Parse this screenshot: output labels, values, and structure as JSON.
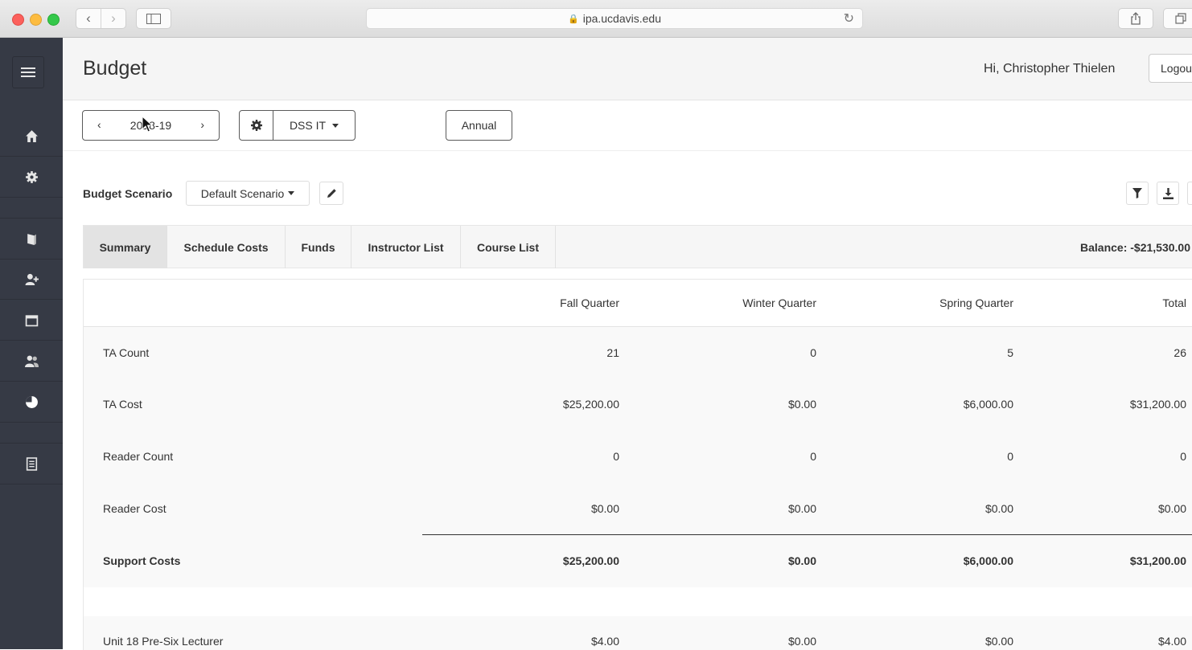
{
  "browser": {
    "url": "ipa.ucdavis.edu"
  },
  "header": {
    "title": "Budget",
    "greeting": "Hi, Christopher Thielen",
    "logout_label": "Logou"
  },
  "toolbar": {
    "year": "2018-19",
    "department": "DSS IT",
    "view_mode": "Annual"
  },
  "scenario": {
    "label": "Budget Scenario",
    "selected": "Default Scenario"
  },
  "tabs": [
    {
      "label": "Summary",
      "active": true
    },
    {
      "label": "Schedule Costs",
      "active": false
    },
    {
      "label": "Funds",
      "active": false
    },
    {
      "label": "Instructor List",
      "active": false
    },
    {
      "label": "Course List",
      "active": false
    }
  ],
  "balance": "Balance: -$21,530.00",
  "table": {
    "columns": [
      "Fall Quarter",
      "Winter Quarter",
      "Spring Quarter",
      "Total"
    ],
    "rows": [
      {
        "label": "TA Count",
        "values": [
          "21",
          "0",
          "5",
          "26"
        ]
      },
      {
        "label": "TA Cost",
        "values": [
          "$25,200.00",
          "$0.00",
          "$6,000.00",
          "$31,200.00"
        ]
      },
      {
        "label": "Reader Count",
        "values": [
          "0",
          "0",
          "0",
          "0"
        ]
      },
      {
        "label": "Reader Cost",
        "values": [
          "$0.00",
          "$0.00",
          "$0.00",
          "$0.00"
        ]
      },
      {
        "label": "Support Costs",
        "values": [
          "$25,200.00",
          "$0.00",
          "$6,000.00",
          "$31,200.00"
        ]
      },
      {
        "label": "Unit 18 Pre-Six Lecturer",
        "values": [
          "$4.00",
          "$0.00",
          "$0.00",
          "$4.00"
        ]
      }
    ]
  },
  "icons": {
    "nav": [
      "menu-icon",
      "home-icon",
      "gear-icon",
      "book-icon",
      "add-person-icon",
      "calendar-icon",
      "people-icon",
      "pie-chart-icon",
      "document-icon"
    ]
  },
  "colors": {
    "sidebar": "#363a45",
    "active_tab": "#e3e3e3"
  }
}
